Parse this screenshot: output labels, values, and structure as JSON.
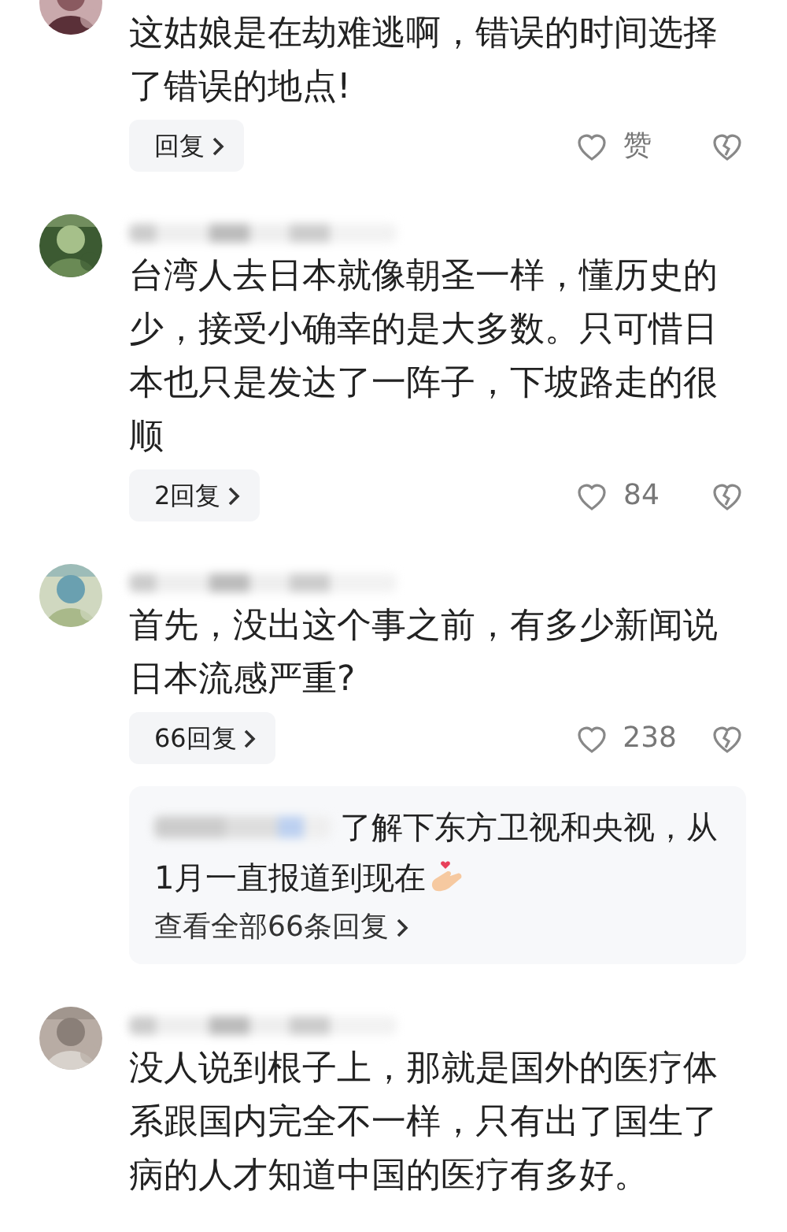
{
  "comments": [
    {
      "text": "这姑娘是在劫难逃啊，错误的时间选择了错误的地点!",
      "reply_button": "回复",
      "likes": "赞"
    },
    {
      "text": "台湾人去日本就像朝圣一样，懂历史的少，接受小确幸的是大多数。只可惜日本也只是发达了一阵子，下坡路走的很顺",
      "reply_button": "2回复",
      "likes": "84"
    },
    {
      "text": "首先，没出这个事之前，有多少新闻说日本流感严重?",
      "reply_button": "66回复",
      "likes": "238",
      "sub_reply": {
        "text_lines": [
          "了解下东方卫视和央视，从",
          "1月一直报道到现在"
        ],
        "view_all": "查看全部66条回复"
      }
    },
    {
      "text": "没人说到根子上，那就是国外的医疗体系跟国内完全不一样，只有出了国生了病的人才知道中国的医疗有多好。"
    }
  ]
}
